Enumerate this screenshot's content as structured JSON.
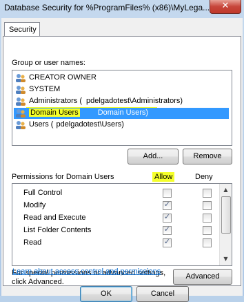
{
  "window": {
    "title": "Database Security for %ProgramFiles% (x86)\\MyLega...",
    "close_glyph": "✕"
  },
  "tab": {
    "label": "Security"
  },
  "groups": {
    "label": "Group or user names:",
    "items": [
      {
        "name": "CREATOR OWNER",
        "icon": "user-group-icon"
      },
      {
        "name": "SYSTEM",
        "icon": "user-group-icon"
      },
      {
        "name": "Administrators (",
        "name_suffix": "pdelgadotest\\Administrators)",
        "icon": "user-group-icon"
      },
      {
        "name": "Domain Users",
        "name_suffix": "Domain Users)",
        "icon": "user-group-icon",
        "selected": true
      },
      {
        "name": "Users (",
        "name_suffix": "pdelgadotest\\Users)",
        "icon": "user-group-icon"
      }
    ]
  },
  "buttons": {
    "add": "Add...",
    "remove": "Remove",
    "advanced": "Advanced",
    "ok": "OK",
    "cancel": "Cancel"
  },
  "permissions": {
    "label": "Permissions for Domain Users",
    "allow_header": "Allow",
    "deny_header": "Deny",
    "rows": [
      {
        "name": "Full Control",
        "allow": false,
        "deny": false
      },
      {
        "name": "Modify",
        "allow": true,
        "deny": false
      },
      {
        "name": "Read and Execute",
        "allow": true,
        "deny": false
      },
      {
        "name": "List Folder Contents",
        "allow": true,
        "deny": false
      },
      {
        "name": "Read",
        "allow": true,
        "deny": false
      }
    ],
    "check_glyph": "✓"
  },
  "special": {
    "text_line1": "For special permissions or advanced settings,",
    "text_line2": "click Advanced."
  },
  "link": {
    "text": "Learn about access control and permissions"
  },
  "colors": {
    "selection": "#3399ff",
    "highlight_marker": "#f5ff2a",
    "link": "#0066cc"
  }
}
